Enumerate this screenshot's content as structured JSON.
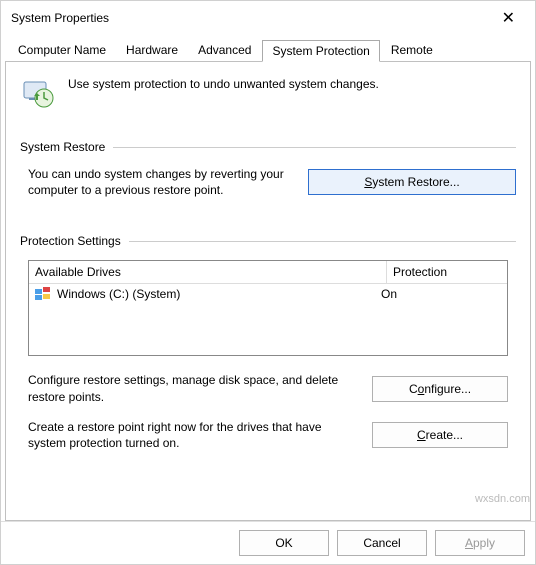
{
  "window": {
    "title": "System Properties"
  },
  "tabs": {
    "computer_name": "Computer Name",
    "hardware": "Hardware",
    "advanced": "Advanced",
    "system_protection": "System Protection",
    "remote": "Remote"
  },
  "description": "Use system protection to undo unwanted system changes.",
  "system_restore": {
    "header": "System Restore",
    "text": "You can undo system changes by reverting your computer to a previous restore point.",
    "button_prefix": "S",
    "button_rest": "ystem Restore..."
  },
  "protection_settings": {
    "header": "Protection Settings",
    "columns": {
      "drives": "Available Drives",
      "protection": "Protection"
    },
    "rows": [
      {
        "drive": "Windows (C:) (System)",
        "protection": "On"
      }
    ],
    "configure": {
      "text": "Configure restore settings, manage disk space, and delete restore points.",
      "button_prefix": "C",
      "button_u": "o",
      "button_rest": "nfigure..."
    },
    "create": {
      "text": "Create a restore point right now for the drives that have system protection turned on.",
      "button_u": "C",
      "button_rest": "reate..."
    }
  },
  "footer": {
    "ok": "OK",
    "cancel": "Cancel",
    "apply_u": "A",
    "apply_rest": "pply"
  },
  "watermark": "wxsdn.com"
}
